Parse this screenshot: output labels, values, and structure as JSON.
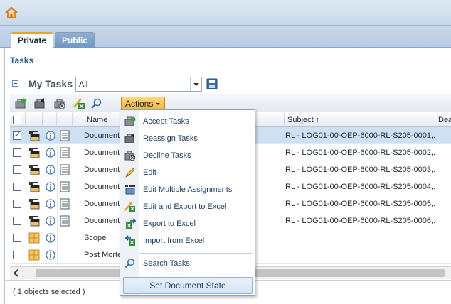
{
  "tabs": [
    {
      "label": "Private",
      "active": true
    },
    {
      "label": "Public",
      "active": false
    }
  ],
  "section_title": "Tasks",
  "my_tasks": {
    "label": "My Tasks",
    "filter_value": "All"
  },
  "toolbar": {
    "icons": [
      "accept-task-icon",
      "reassign-task-icon",
      "decline-task-icon",
      "export-excel-icon",
      "search-icon"
    ],
    "actions_label": "Actions"
  },
  "grid": {
    "columns": [
      "Name",
      "Subject ↑",
      "Dead"
    ],
    "rows": [
      {
        "name": "Document",
        "subject": "RL - LOG01-00-OEP-6000-RL-S205-0001,...",
        "type": "document",
        "checked": true,
        "selected": true
      },
      {
        "name": "Document",
        "subject": "RL - LOG01-00-OEP-6000-RL-S205-0002,...",
        "type": "document",
        "checked": false,
        "selected": false
      },
      {
        "name": "Document",
        "subject": "RL - LOG01-00-OEP-6000-RL-S205-0003,...",
        "type": "document",
        "checked": false,
        "selected": false
      },
      {
        "name": "Document",
        "subject": "RL - LOG01-00-OEP-6000-RL-S205-0004,...",
        "type": "document",
        "checked": false,
        "selected": false
      },
      {
        "name": "Document",
        "subject": "RL - LOG01-00-OEP-6000-RL-S205-0005,...",
        "type": "document",
        "checked": false,
        "selected": false
      },
      {
        "name": "Document",
        "subject": "RL - LOG01-00-OEP-6000-RL-S205-0006,...",
        "type": "document",
        "checked": false,
        "selected": false
      },
      {
        "name": "Scope",
        "subject": "",
        "type": "folder",
        "checked": false,
        "selected": false
      },
      {
        "name": "Post Morte",
        "subject": "",
        "type": "folder",
        "checked": false,
        "selected": false
      }
    ]
  },
  "status_text": "( 1 objects selected )",
  "actions_menu": {
    "items": [
      {
        "label": "Accept Tasks",
        "icon": "accept-task-icon"
      },
      {
        "label": "Reassign Tasks",
        "icon": "reassign-task-icon"
      },
      {
        "label": "Decline Tasks",
        "icon": "decline-task-icon"
      },
      {
        "label": "Edit",
        "icon": "pencil-icon"
      },
      {
        "label": "Edit Multiple Assignments",
        "icon": "multi-assign-icon"
      },
      {
        "label": "Edit and Export to Excel",
        "icon": "edit-excel-icon"
      },
      {
        "label": "Export to Excel",
        "icon": "export-excel-icon"
      },
      {
        "label": "Import from Excel",
        "icon": "import-excel-icon"
      },
      {
        "label": "Search Tasks",
        "icon": "search-icon"
      },
      {
        "label": "Set Document State",
        "icon": ""
      }
    ]
  },
  "colors": {
    "accent_orange": "#f5b33a",
    "selected_row": "#cfe0f2",
    "header_blue": "#2d5b8a"
  }
}
